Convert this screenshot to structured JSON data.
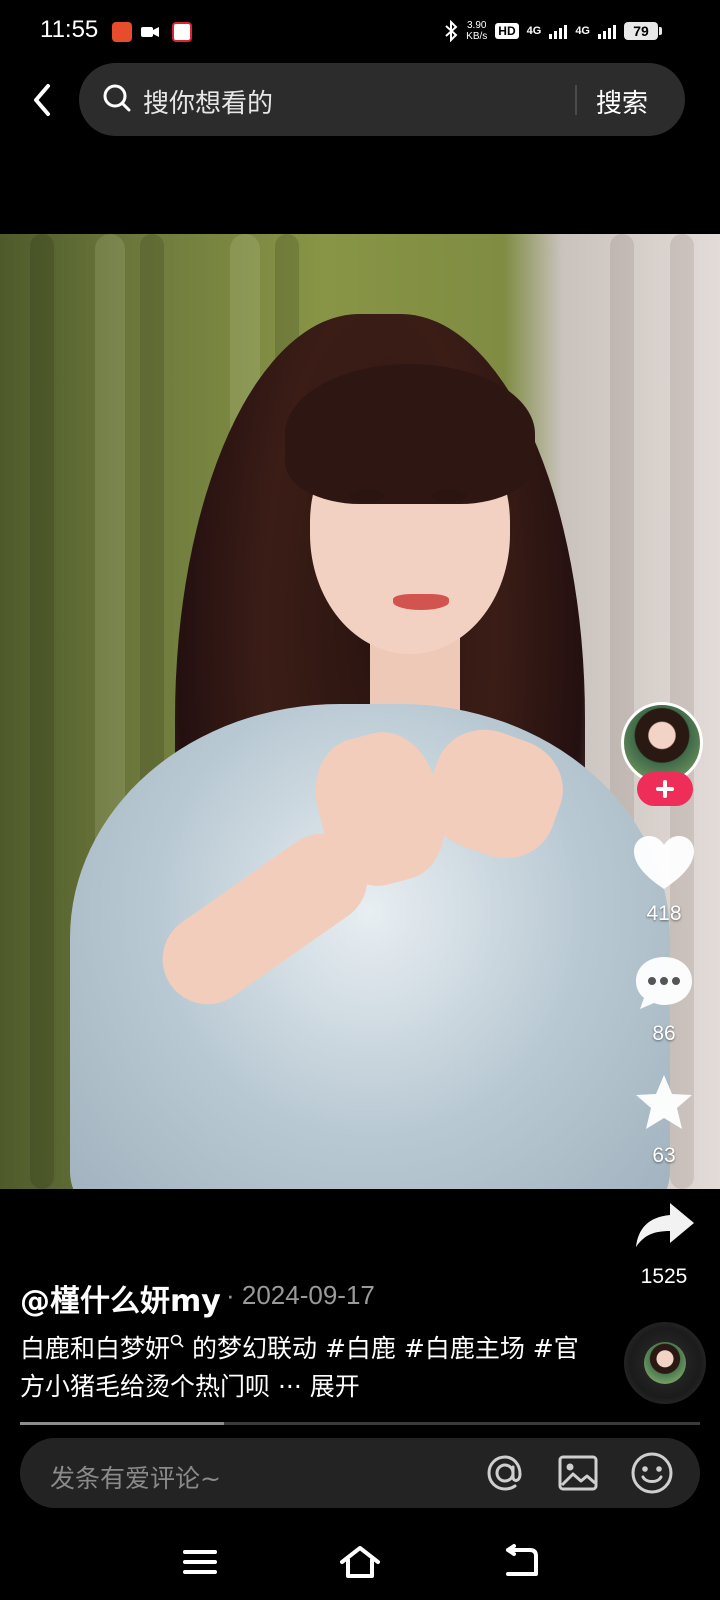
{
  "status_bar": {
    "time": "11:55",
    "net_speed_value": "3.90",
    "net_speed_unit": "KB/s",
    "hd_label": "HD",
    "network_1": "4G",
    "network_2": "4G",
    "battery": "79"
  },
  "search": {
    "placeholder": "搜你想看的",
    "button_label": "搜索"
  },
  "video": {
    "progress_fraction": 0.3
  },
  "actions": {
    "like_count": "418",
    "comment_count": "86",
    "favorite_count": "63",
    "share_count": "1525"
  },
  "post": {
    "author": "@槿什么妍my",
    "date": "· 2024-09-17",
    "caption_part1": "白鹿和白梦妍",
    "caption_part2": "的梦幻联动",
    "tag1": "#白鹿",
    "tag2": "#白鹿主场",
    "tag3": "#官方小猪毛给烫个热门呗",
    "ellipsis": "···",
    "expand": "展开"
  },
  "comment": {
    "placeholder": "发条有爱评论~"
  },
  "colors": {
    "background": "#000000",
    "follow_accent": "#ee2d58",
    "search_box": "#2c2c2c"
  }
}
